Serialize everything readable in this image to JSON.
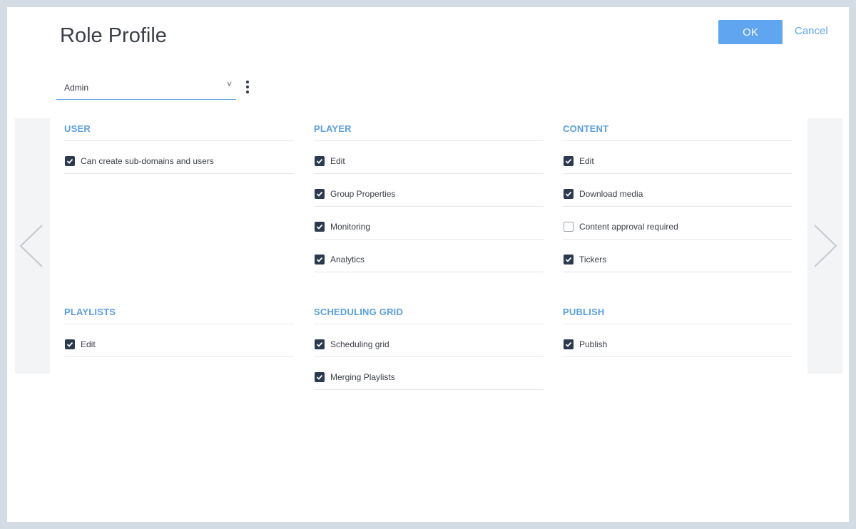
{
  "dialog": {
    "title": "Role Profile",
    "ok_label": "OK",
    "cancel_label": "Cancel"
  },
  "role_select": {
    "value": "Admin",
    "chevron": "˅"
  },
  "icons": {
    "kebab": "more-vertical-icon",
    "prev": "chevron-left-icon",
    "next": "chevron-right-icon",
    "check": "checkmark-icon"
  },
  "colors": {
    "accent": "#5fa5f0",
    "section_title": "#5a9fe0",
    "checkbox_checked": "#2c3a4f",
    "background": "#d3dbe4"
  },
  "sections": [
    {
      "title": "USER",
      "items": [
        {
          "label": "Can create sub-domains and users",
          "checked": true
        }
      ]
    },
    {
      "title": "PLAYER",
      "items": [
        {
          "label": "Edit",
          "checked": true
        },
        {
          "label": "Group Properties",
          "checked": true
        },
        {
          "label": "Monitoring",
          "checked": true
        },
        {
          "label": "Analytics",
          "checked": true
        }
      ]
    },
    {
      "title": "CONTENT",
      "items": [
        {
          "label": "Edit",
          "checked": true
        },
        {
          "label": "Download media",
          "checked": true
        },
        {
          "label": "Content approval required",
          "checked": false
        },
        {
          "label": "Tickers",
          "checked": true
        }
      ]
    },
    {
      "title": "PLAYLISTS",
      "items": [
        {
          "label": "Edit",
          "checked": true
        }
      ]
    },
    {
      "title": "SCHEDULING GRID",
      "items": [
        {
          "label": "Scheduling grid",
          "checked": true
        },
        {
          "label": "Merging Playlists",
          "checked": true
        }
      ]
    },
    {
      "title": "PUBLISH",
      "items": [
        {
          "label": "Publish",
          "checked": true
        }
      ]
    }
  ]
}
